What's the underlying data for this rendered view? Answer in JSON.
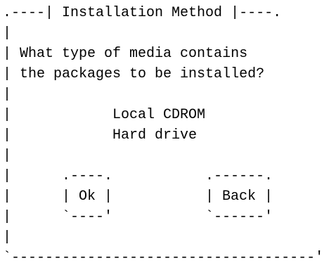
{
  "dialog": {
    "title": "Installation Method",
    "prompt": {
      "line1": "What type of media contains",
      "line2": "the packages to be installed?"
    },
    "media_options": [
      {
        "label": "Local CDROM"
      },
      {
        "label": "Hard drive"
      }
    ],
    "buttons": {
      "ok_label": "Ok",
      "back_label": "Back"
    }
  }
}
